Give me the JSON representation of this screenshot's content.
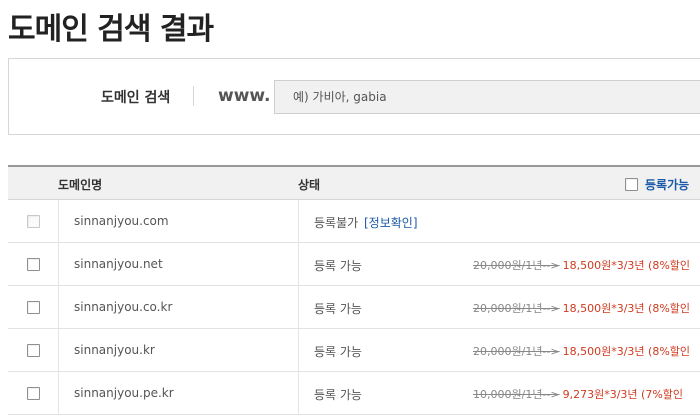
{
  "page": {
    "title": "도메인 검색 결과"
  },
  "search": {
    "label": "도메인 검색",
    "prefix": "www.",
    "placeholder": "예) 가비아, gabia"
  },
  "table": {
    "headers": {
      "domain": "도메인명",
      "status": "상태",
      "available": "등록가능"
    },
    "rows": [
      {
        "domain": "sinnanjyou.com",
        "status": "등록불가",
        "link": "[정보확인]",
        "old_price": "",
        "new_price": ""
      },
      {
        "domain": "sinnanjyou.net",
        "status": "등록 가능",
        "link": "",
        "old_price": "20,000원/1년-->",
        "new_price": "18,500원*3/3년 (8%할인"
      },
      {
        "domain": "sinnanjyou.co.kr",
        "status": "등록 가능",
        "link": "",
        "old_price": "20,000원/1년-->",
        "new_price": "18,500원*3/3년 (8%할인"
      },
      {
        "domain": "sinnanjyou.kr",
        "status": "등록 가능",
        "link": "",
        "old_price": "20,000원/1년-->",
        "new_price": "18,500원*3/3년 (8%할인"
      },
      {
        "domain": "sinnanjyou.pe.kr",
        "status": "등록 가능",
        "link": "",
        "old_price": "10,000원/1년-->",
        "new_price": "9,273원*3/3년 (7%할인"
      }
    ]
  },
  "colors": {
    "link": "#1a5aa8",
    "discount": "#d03a1f",
    "header_bg": "#f1f1f1"
  }
}
